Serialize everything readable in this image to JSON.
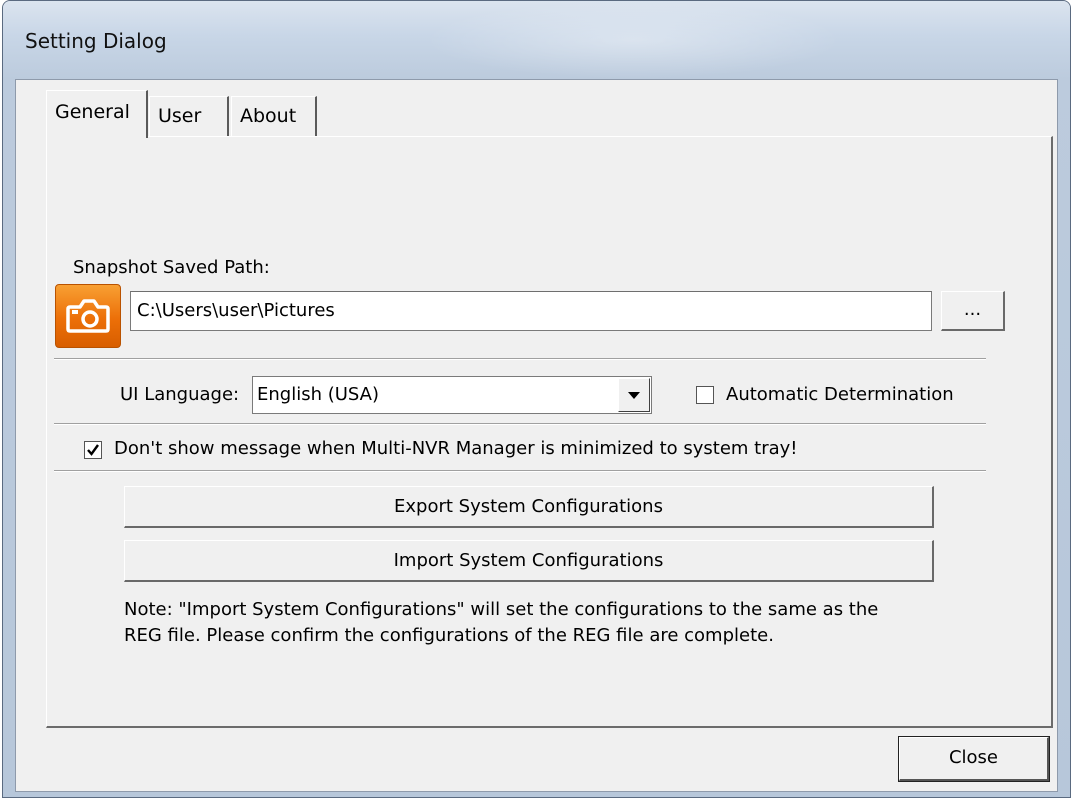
{
  "window": {
    "title": "Setting Dialog"
  },
  "tabs": [
    {
      "label": "General",
      "active": true
    },
    {
      "label": "User",
      "active": false
    },
    {
      "label": "About",
      "active": false
    }
  ],
  "general": {
    "snapshot_label": "Snapshot Saved Path:",
    "snapshot_icon": "camera-icon",
    "snapshot_path": "C:\\Users\\user\\Pictures",
    "browse_label": "...",
    "language_label": "UI Language:",
    "language_value": "English (USA)",
    "auto_determination_label": "Automatic Determination",
    "auto_determination_checked": false,
    "tray_message_label": "Don't show message when Multi-NVR Manager is minimized to system tray!",
    "tray_message_checked": true,
    "export_label": "Export System Configurations",
    "import_label": "Import System Configurations",
    "note_line1": "Note: \"Import System Configurations\" will set the configurations to the same as the",
    "note_line2": "REG file. Please confirm the configurations of the REG file are complete."
  },
  "footer": {
    "close_label": "Close"
  },
  "colors": {
    "camera_orange": "#ec6f08",
    "dialog_face": "#f0f0f0",
    "title_bar": "#c8d6e7"
  }
}
